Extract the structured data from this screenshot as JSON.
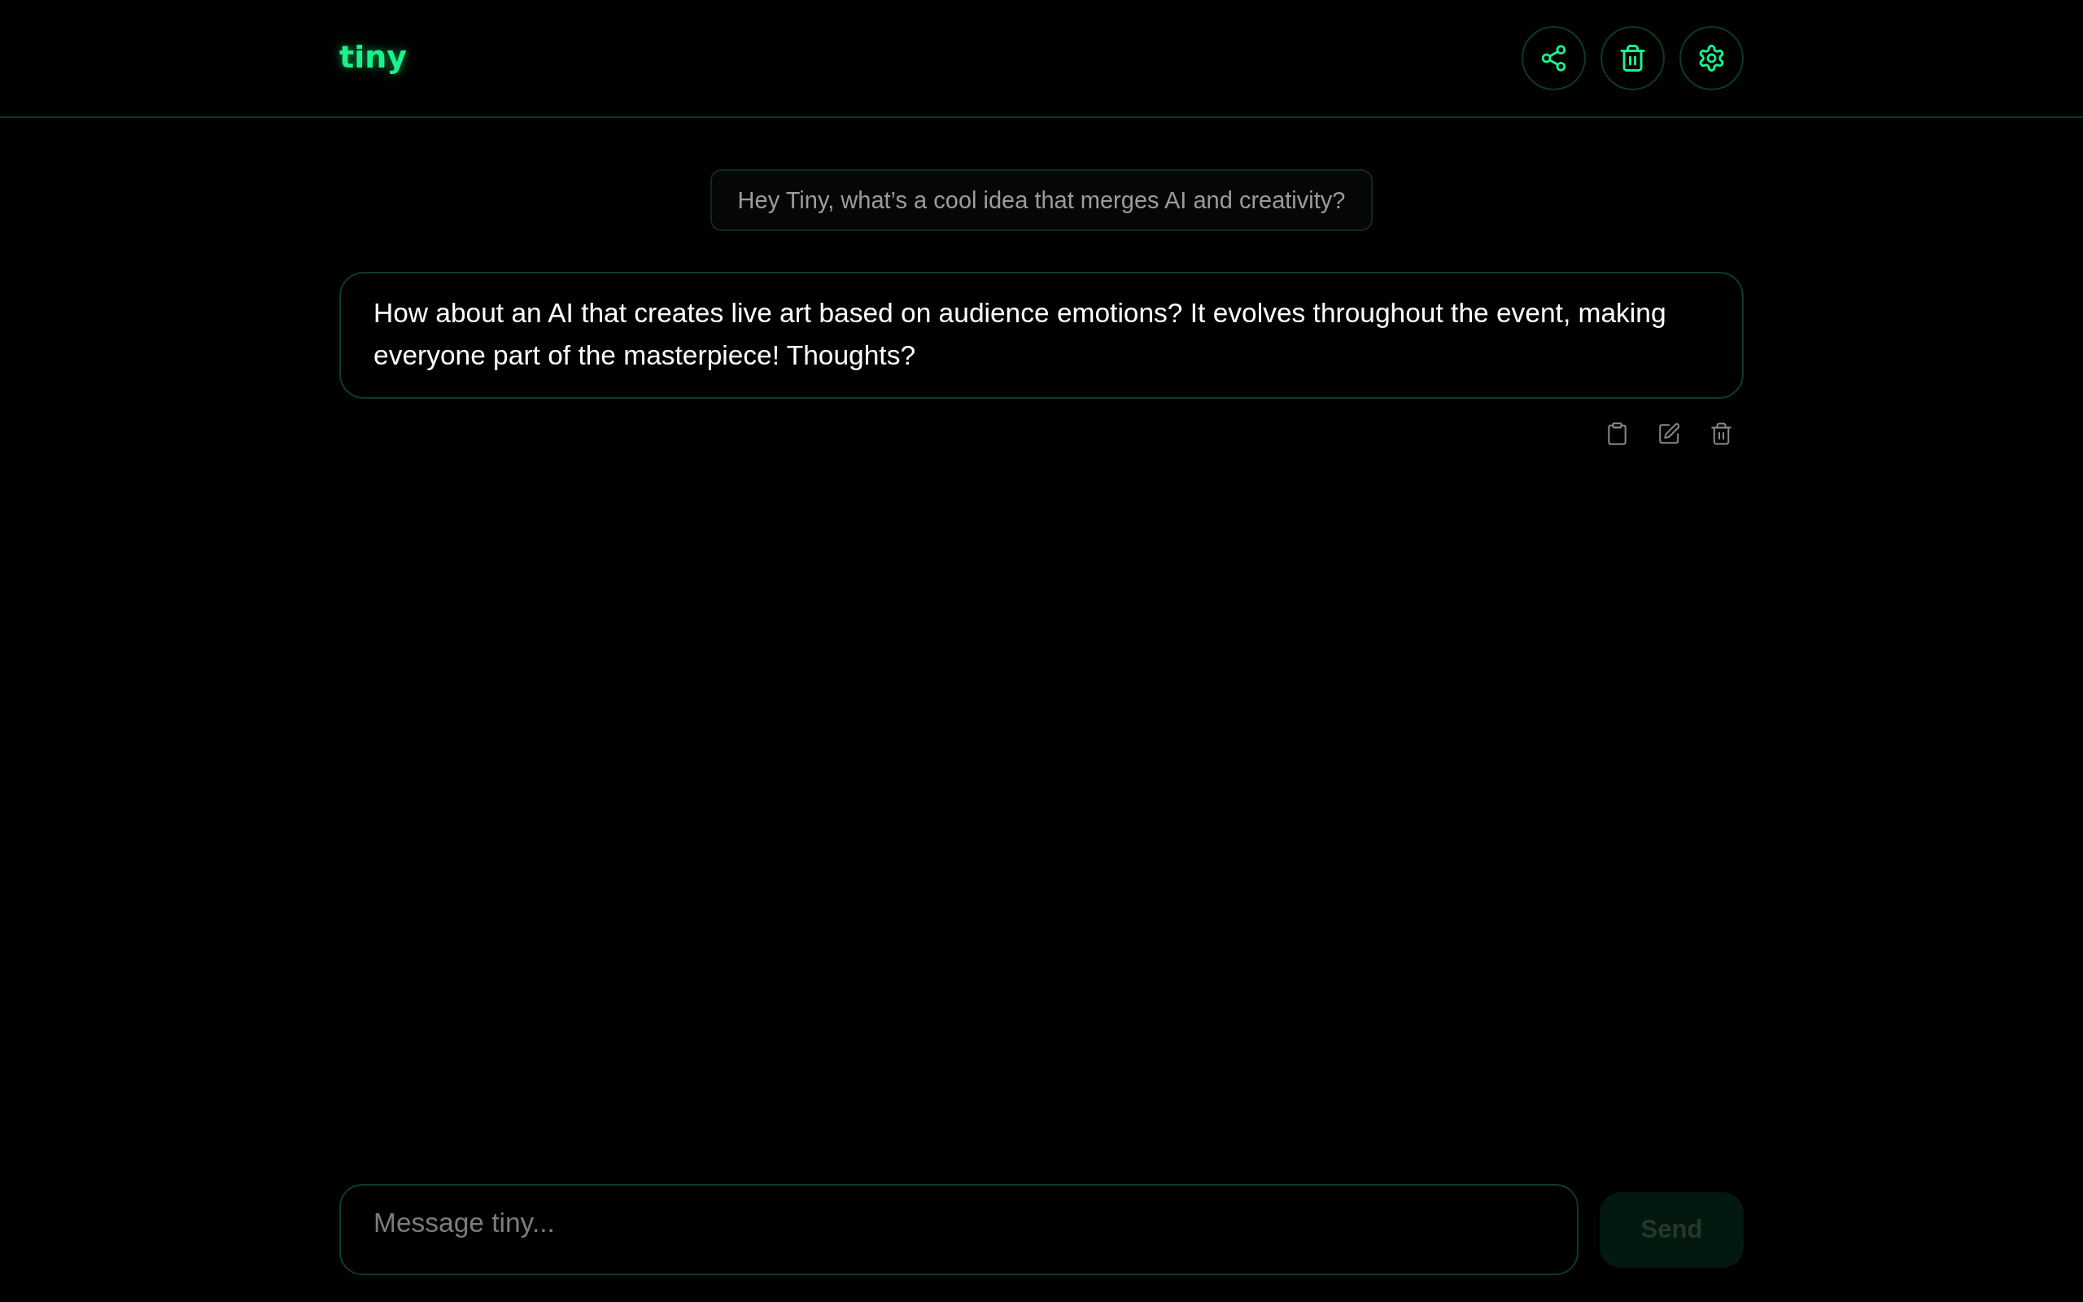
{
  "header": {
    "logo": "tiny",
    "buttons": [
      {
        "kind": "share"
      },
      {
        "kind": "trash"
      },
      {
        "kind": "settings"
      }
    ]
  },
  "messages": [
    {
      "kind": "user",
      "text": "Hey Tiny, what’s a cool idea that merges AI and creativity?"
    },
    {
      "kind": "assistant",
      "text": "How about an AI that creates live art based on audience emotions? It evolves throughout the event, making everyone part of the masterpiece! Thoughts?",
      "actions": [
        {
          "kind": "copy"
        },
        {
          "kind": "edit"
        },
        {
          "kind": "delete"
        }
      ]
    }
  ],
  "composer": {
    "placeholder": "Message tiny...",
    "send": {
      "label": "Send",
      "disabled": true
    }
  }
}
